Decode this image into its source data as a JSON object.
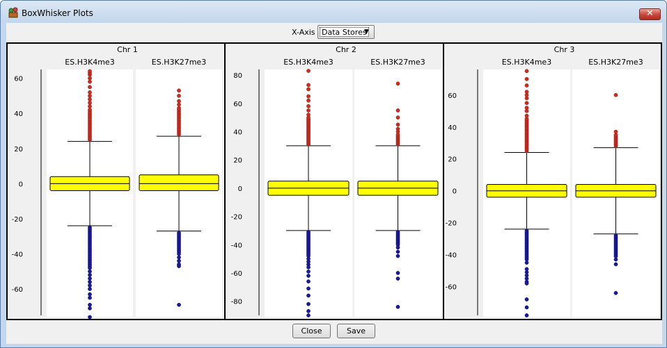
{
  "window": {
    "title": "BoxWhisker Plots",
    "close_glyph": "✕"
  },
  "controls": {
    "xaxis_label": "X-Axis",
    "xaxis_value": "Data Stores",
    "dropdown_glyph": "▼"
  },
  "buttons": {
    "close_label": "Close",
    "save_label": "Save"
  },
  "colors": {
    "box_fill": "#ffff00",
    "outlier_high": "#d42a1e",
    "outlier_low": "#1a1aa0",
    "plot_bg": "#ffffff"
  },
  "chart_data": [
    {
      "type": "boxplot",
      "title": "Chr 1",
      "ylim": [
        -75,
        65
      ],
      "yticks": [
        60,
        40,
        20,
        0,
        -20,
        -40,
        -60
      ],
      "series": [
        {
          "name": "ES.H3K4me3",
          "median": 0,
          "q1": -4,
          "q3": 4,
          "whisker_low": -24,
          "whisker_high": 24,
          "outliers_high": [
            25,
            26,
            27,
            28,
            29,
            30,
            31,
            32,
            33,
            34,
            35,
            36,
            37,
            38,
            39,
            40,
            41,
            42,
            44,
            46,
            48,
            50,
            52,
            55,
            58,
            60,
            62,
            63,
            64
          ],
          "outliers_low": [
            -25,
            -26,
            -27,
            -28,
            -29,
            -30,
            -31,
            -32,
            -33,
            -34,
            -35,
            -36,
            -37,
            -38,
            -39,
            -40,
            -41,
            -42,
            -43,
            -44,
            -45,
            -46,
            -47,
            -48,
            -50,
            -52,
            -54,
            -56,
            -58,
            -60,
            -63,
            -65,
            -69,
            -71,
            -76
          ]
        },
        {
          "name": "ES.H3K27me3",
          "median": 0,
          "q1": -4,
          "q3": 5,
          "whisker_low": -27,
          "whisker_high": 27,
          "outliers_high": [
            28,
            29,
            30,
            31,
            32,
            33,
            34,
            35,
            36,
            37,
            38,
            39,
            40,
            41,
            42,
            43,
            45,
            47,
            50,
            53
          ],
          "outliers_low": [
            -28,
            -29,
            -30,
            -31,
            -32,
            -33,
            -34,
            -35,
            -36,
            -37,
            -38,
            -39,
            -40,
            -42,
            -44,
            -46,
            -47,
            -69
          ]
        }
      ]
    },
    {
      "type": "boxplot",
      "title": "Chr 2",
      "ylim": [
        -90,
        84
      ],
      "yticks": [
        80,
        60,
        40,
        20,
        0,
        -20,
        -40,
        -60,
        -80
      ],
      "series": [
        {
          "name": "ES.H3K4me3",
          "median": 0,
          "q1": -5,
          "q3": 5,
          "whisker_low": -30,
          "whisker_high": 30,
          "outliers_high": [
            31,
            32,
            33,
            34,
            35,
            36,
            37,
            38,
            39,
            40,
            41,
            42,
            43,
            44,
            45,
            46,
            47,
            48,
            49,
            50,
            52,
            55,
            58,
            62,
            65,
            70,
            73,
            83
          ],
          "outliers_low": [
            -31,
            -32,
            -33,
            -34,
            -35,
            -36,
            -37,
            -38,
            -39,
            -40,
            -41,
            -42,
            -43,
            -44,
            -45,
            -46,
            -47,
            -48,
            -50,
            -52,
            -54,
            -56,
            -59,
            -62,
            -66,
            -71,
            -76,
            -82,
            -87,
            -90
          ]
        },
        {
          "name": "ES.H3K27me3",
          "median": 0,
          "q1": -5,
          "q3": 5,
          "whisker_low": -30,
          "whisker_high": 30,
          "outliers_high": [
            31,
            32,
            33,
            34,
            35,
            36,
            37,
            38,
            40,
            42,
            45,
            50,
            55,
            74
          ],
          "outliers_low": [
            -31,
            -32,
            -33,
            -34,
            -35,
            -36,
            -37,
            -38,
            -39,
            -40,
            -42,
            -45,
            -48,
            -60,
            -64,
            -84
          ]
        }
      ]
    },
    {
      "type": "boxplot",
      "title": "Chr 3",
      "ylim": [
        -78,
        76
      ],
      "yticks": [
        60,
        40,
        20,
        0,
        -20,
        -40,
        -60
      ],
      "series": [
        {
          "name": "ES.H3K4me3",
          "median": 0,
          "q1": -4,
          "q3": 4,
          "whisker_low": -24,
          "whisker_high": 24,
          "outliers_high": [
            25,
            26,
            27,
            28,
            29,
            30,
            31,
            32,
            33,
            34,
            35,
            36,
            37,
            38,
            39,
            40,
            41,
            42,
            43,
            44,
            45,
            47,
            50,
            52,
            55,
            58,
            60,
            62,
            66,
            70,
            75
          ],
          "outliers_low": [
            -25,
            -26,
            -27,
            -28,
            -29,
            -30,
            -31,
            -32,
            -33,
            -34,
            -35,
            -36,
            -37,
            -38,
            -39,
            -40,
            -41,
            -42,
            -43,
            -45,
            -49,
            -51,
            -53,
            -55,
            -57,
            -58,
            -68,
            -73,
            -78
          ]
        },
        {
          "name": "ES.H3K27me3",
          "median": 0,
          "q1": -4,
          "q3": 4,
          "whisker_low": -27,
          "whisker_high": 27,
          "outliers_high": [
            28,
            29,
            30,
            31,
            32,
            33,
            34,
            35,
            37,
            60
          ],
          "outliers_low": [
            -28,
            -29,
            -30,
            -31,
            -32,
            -33,
            -34,
            -35,
            -36,
            -37,
            -38,
            -39,
            -40,
            -41,
            -43,
            -46,
            -64
          ]
        }
      ]
    }
  ]
}
